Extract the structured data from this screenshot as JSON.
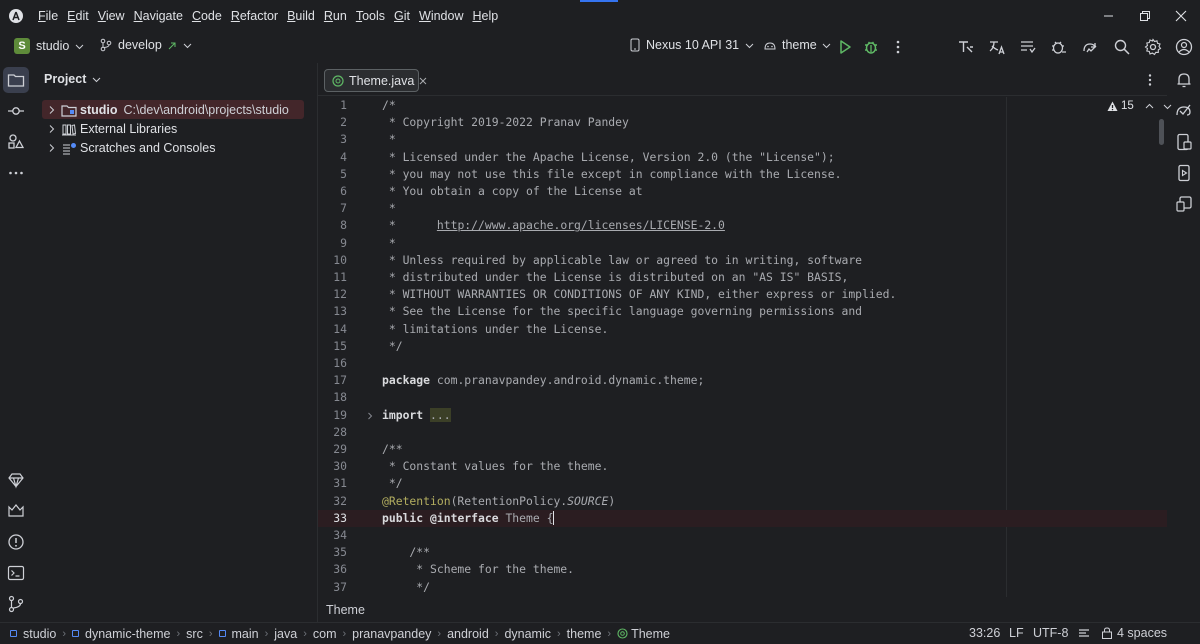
{
  "menu": {
    "items": [
      {
        "label": "File",
        "u": "F",
        "rest": "ile"
      },
      {
        "label": "Edit",
        "u": "E",
        "rest": "dit"
      },
      {
        "label": "View",
        "u": "V",
        "rest": "iew"
      },
      {
        "label": "Navigate",
        "u": "N",
        "rest": "avigate"
      },
      {
        "label": "Code",
        "u": "C",
        "rest": "ode"
      },
      {
        "label": "Refactor",
        "u": "R",
        "rest": "efactor"
      },
      {
        "label": "Build",
        "u": "B",
        "rest": "uild"
      },
      {
        "label": "Run",
        "u": "R",
        "rest": "un"
      },
      {
        "label": "Tools",
        "u": "T",
        "rest": "ools"
      },
      {
        "label": "Git",
        "u": "G",
        "rest": "it"
      },
      {
        "label": "Window",
        "u": "W",
        "rest": "indow"
      },
      {
        "label": "Help",
        "u": "H",
        "rest": "elp"
      }
    ]
  },
  "toolbar": {
    "project_badge": "S",
    "project_name": "studio",
    "branch": "develop",
    "device": "Nexus 10 API 31",
    "run_config": "theme",
    "colors": {
      "run": "#5fb865",
      "debug": "#5fb865",
      "project_badge_bg": "#5e8b3a"
    }
  },
  "project_panel": {
    "title": "Project",
    "items": [
      {
        "name": "studio",
        "path": "C:\\dev\\android\\projects\\studio"
      },
      {
        "name": "External Libraries"
      },
      {
        "name": "Scratches and Consoles"
      }
    ]
  },
  "editor": {
    "tab_label": "Theme.java",
    "warnings_count": "15",
    "breadcrumb": "Theme",
    "lines": [
      {
        "n": "1",
        "t": "/*"
      },
      {
        "n": "2",
        "t": " * Copyright 2019-2022 Pranav Pandey"
      },
      {
        "n": "3",
        "t": " *"
      },
      {
        "n": "4",
        "t": " * Licensed under the Apache License, Version 2.0 (the \"License\");"
      },
      {
        "n": "5",
        "t": " * you may not use this file except in compliance with the License."
      },
      {
        "n": "6",
        "t": " * You obtain a copy of the License at"
      },
      {
        "n": "7",
        "t": " *"
      },
      {
        "n": "8",
        "t_pre": " *      ",
        "t_url": "http://www.apache.org/licenses/LICENSE-2.0"
      },
      {
        "n": "9",
        "t": " *"
      },
      {
        "n": "10",
        "t": " * Unless required by applicable law or agreed to in writing, software"
      },
      {
        "n": "11",
        "t": " * distributed under the License is distributed on an \"AS IS\" BASIS,"
      },
      {
        "n": "12",
        "t": " * WITHOUT WARRANTIES OR CONDITIONS OF ANY KIND, either express or implied."
      },
      {
        "n": "13",
        "t": " * See the License for the specific language governing permissions and"
      },
      {
        "n": "14",
        "t": " * limitations under the License."
      },
      {
        "n": "15",
        "t": " */"
      },
      {
        "n": "16",
        "t": ""
      },
      {
        "n": "17",
        "kw": "package",
        "rest": " com.pranavpandey.android.dynamic.theme;"
      },
      {
        "n": "18",
        "t": ""
      },
      {
        "n": "19",
        "kw": "import",
        "fold": "..."
      },
      {
        "n": "28",
        "t": ""
      },
      {
        "n": "29",
        "t": "/**"
      },
      {
        "n": "30",
        "t": " * Constant values for the theme."
      },
      {
        "n": "31",
        "t": " */"
      },
      {
        "n": "32",
        "ann": "@Retention",
        "p1": "(RetentionPolicy.",
        "it": "SOURCE",
        "p2": ")"
      },
      {
        "n": "33",
        "kw": "public",
        "kw2": "@interface",
        "rest": " Theme {"
      },
      {
        "n": "34",
        "t": ""
      },
      {
        "n": "35",
        "t": "    /**"
      },
      {
        "n": "36",
        "t": "     * Scheme for the theme."
      },
      {
        "n": "37",
        "t": "     */"
      }
    ]
  },
  "status": {
    "breadcrumbs": [
      "studio",
      "dynamic-theme",
      "src",
      "main",
      "java",
      "com",
      "pranavpandey",
      "android",
      "dynamic",
      "theme",
      "Theme"
    ],
    "position": "33:26",
    "line_sep": "LF",
    "encoding": "UTF-8",
    "indent": "4 spaces"
  }
}
